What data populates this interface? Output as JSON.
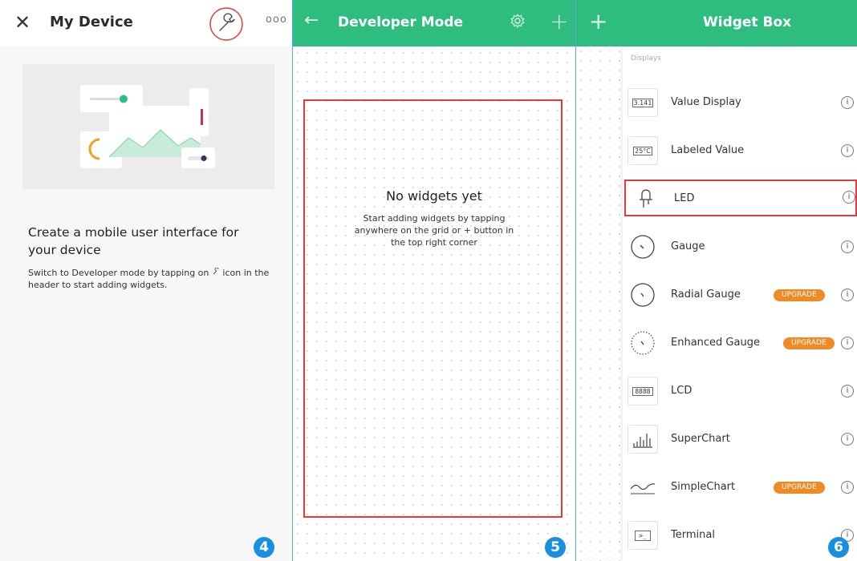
{
  "panel1": {
    "title": "My Device",
    "dots": "ooo",
    "headline": "Create a mobile user interface for your device",
    "desc_before": "Switch to Developer mode by tapping on",
    "desc_after": " icon in the header to start adding widgets.",
    "badge": "4"
  },
  "panel2": {
    "title": "Developer Mode",
    "empty_title": "No widgets yet",
    "empty_desc": "Start adding widgets by tapping anywhere on the grid or + button in the top right corner",
    "badge": "5"
  },
  "panel3": {
    "title": "Widget Box",
    "section": "Displays",
    "badge": "6",
    "upgrade_label": "UPGRADE",
    "items": [
      {
        "label": "Value Display",
        "icon": "3.141"
      },
      {
        "label": "Labeled Value",
        "icon": "25°C"
      },
      {
        "label": "LED",
        "icon": "led-icon"
      },
      {
        "label": "Gauge",
        "icon": "gauge-icon"
      },
      {
        "label": "Radial Gauge",
        "icon": "radial-gauge-icon"
      },
      {
        "label": "Enhanced Gauge",
        "icon": "enhanced-gauge-icon"
      },
      {
        "label": "LCD",
        "icon": "8888"
      },
      {
        "label": "SuperChart",
        "icon": "superchart-icon"
      },
      {
        "label": "SimpleChart",
        "icon": "simplechart-icon"
      },
      {
        "label": "Terminal",
        "icon": ">_"
      }
    ]
  },
  "colors": {
    "header_green": "#2ebd7e",
    "highlight_red": "#e23b3b",
    "badge_blue": "#1a8fe0",
    "upgrade_orange": "#f08a24"
  }
}
